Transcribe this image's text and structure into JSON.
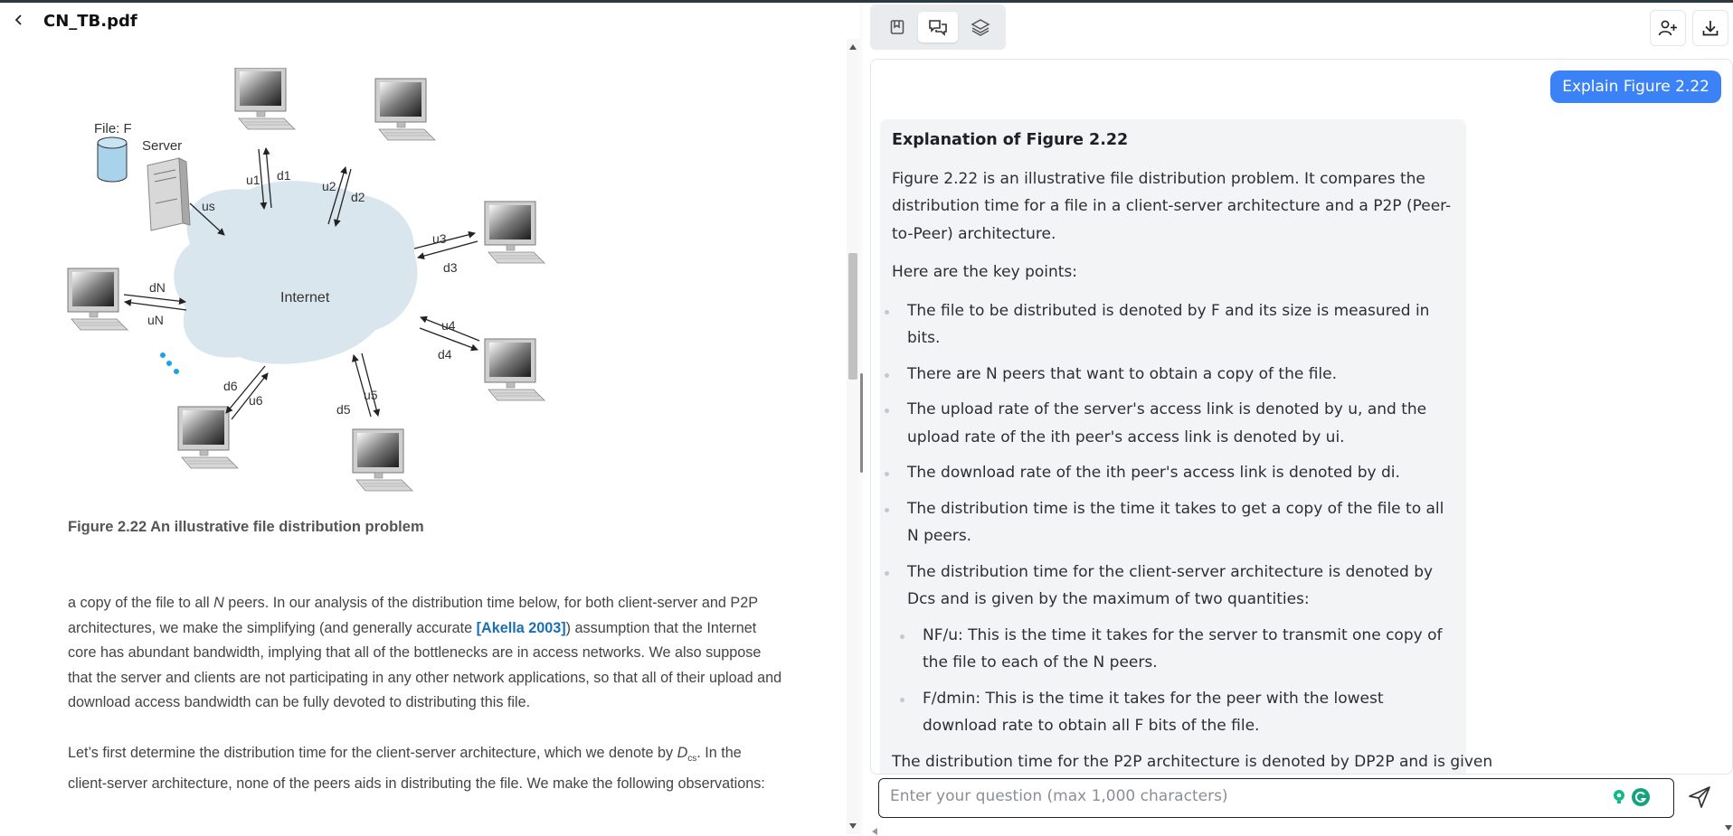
{
  "document": {
    "title": "CN_TB.pdf",
    "figure": {
      "caption": "Figure 2.22 An illustrative file distribution problem",
      "labels": {
        "file": "File: F",
        "server": "Server",
        "internet": "Internet",
        "us": "us",
        "u1": "u1",
        "d1": "d1",
        "u2": "u2",
        "d2": "d2",
        "u3": "u3",
        "d3": "d3",
        "u4": "u4",
        "d4": "d4",
        "u5": "u5",
        "d5": "d5",
        "u6": "u6",
        "d6": "d6",
        "uN": "uN",
        "dN": "dN"
      }
    },
    "para1": {
      "t1": "a copy of the file to all ",
      "n": "N",
      "t2": " peers. In our analysis of the distribution time below, for both client-server and P2P architectures, we make the simplifying (and generally accurate ",
      "cite": "[Akella 2003]",
      "t3": ") assumption that the Internet core has abundant bandwidth, implying that all of the bottlenecks are in access networks. We also suppose that the server and clients are not participating in any other network applications, so that all of their upload and download access bandwidth can be fully devoted to distributing this file."
    },
    "para2": {
      "t1": "Let’s first determine the distribution time for the client-server architecture, which we denote by ",
      "d": "D",
      "sub": "cs",
      "t2": ". In the client-server architecture, none of the peers aids in distributing the file. We make the following observations:"
    }
  },
  "toolbar": {
    "tabs": [
      {
        "name": "bookmark-tab",
        "icon": "bookmark-icon",
        "active": false
      },
      {
        "name": "chat-tab",
        "icon": "chat-icon",
        "active": true
      },
      {
        "name": "layers-tab",
        "icon": "layers-icon",
        "active": false
      }
    ],
    "actions": [
      {
        "name": "add-user-button",
        "icon": "add-user-icon"
      },
      {
        "name": "download-button",
        "icon": "download-icon"
      }
    ]
  },
  "chat": {
    "user_message": "Explain Figure 2.22",
    "answer": {
      "heading": "Explanation of Figure 2.22",
      "intro": "Figure 2.22 is an illustrative file distribution problem. It compares the distribution time for a file in a client-server architecture and a P2P (Peer-to-Peer) architecture.",
      "lead": "Here are the key points:",
      "points": [
        "The file to be distributed is denoted by F and its size is measured in bits.",
        "There are N peers that want to obtain a copy of the file.",
        "The upload rate of the server's access link is denoted by u, and the upload rate of the ith peer's access link is denoted by ui.",
        "The download rate of the ith peer's access link is denoted by di.",
        "The distribution time is the time it takes to get a copy of the file to all N peers.",
        "The distribution time for the client-server architecture is denoted by Dcs and is given by the maximum of two quantities:"
      ],
      "subpoints": [
        "NF/u: This is the time it takes for the server to transmit one copy of the file to each of the N peers.",
        "F/dmin: This is the time it takes for the peer with the lowest download rate to obtain all F bits of the file."
      ],
      "cut_text": "The distribution time for the P2P architecture is denoted by DP2P and is given"
    },
    "input": {
      "placeholder": "Enter your question (max 1,000 characters)",
      "value": ""
    }
  },
  "colors": {
    "accent": "#3b82f6",
    "link": "#1a6fb4",
    "cloud": "#d9e6ee",
    "answer_bg": "#f2f4f6"
  }
}
